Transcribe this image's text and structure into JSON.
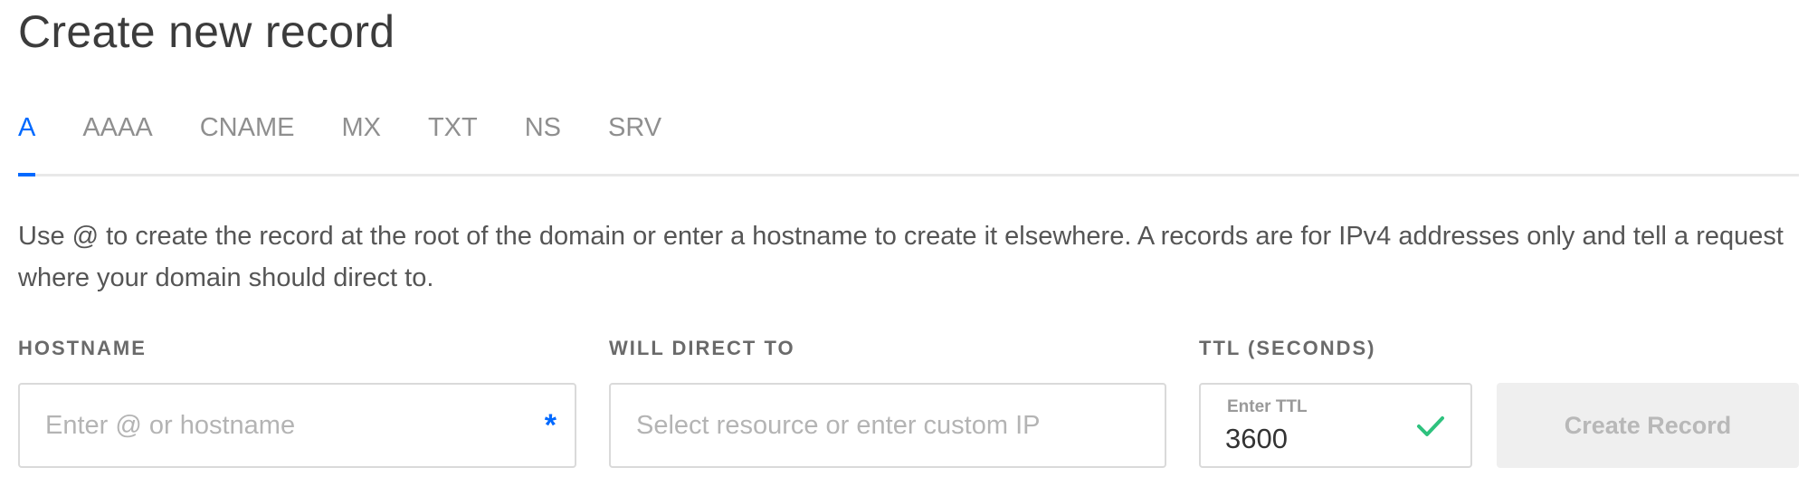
{
  "page": {
    "title": "Create new record"
  },
  "tabs": [
    {
      "label": "A",
      "active": true
    },
    {
      "label": "AAAA",
      "active": false
    },
    {
      "label": "CNAME",
      "active": false
    },
    {
      "label": "MX",
      "active": false
    },
    {
      "label": "TXT",
      "active": false
    },
    {
      "label": "NS",
      "active": false
    },
    {
      "label": "SRV",
      "active": false
    }
  ],
  "description": "Use @ to create the record at the root of the domain or enter a hostname to create it elsewhere. A records are for IPv4 addresses only and tell a request where your domain should direct to.",
  "form": {
    "hostname": {
      "label": "HOSTNAME",
      "placeholder": "Enter @ or hostname",
      "value": "",
      "required_marker": "*"
    },
    "direct_to": {
      "label": "WILL DIRECT TO",
      "placeholder": "Select resource or enter custom IP",
      "value": ""
    },
    "ttl": {
      "label": "TTL (SECONDS)",
      "inner_label": "Enter TTL",
      "value": "3600",
      "valid_icon": "check-icon"
    },
    "submit": {
      "label": "Create Record",
      "enabled": false
    }
  },
  "colors": {
    "accent": "#0069ff",
    "valid": "#2ec27e",
    "disabled_bg": "#efefef",
    "disabled_text": "#b8b8b8"
  }
}
